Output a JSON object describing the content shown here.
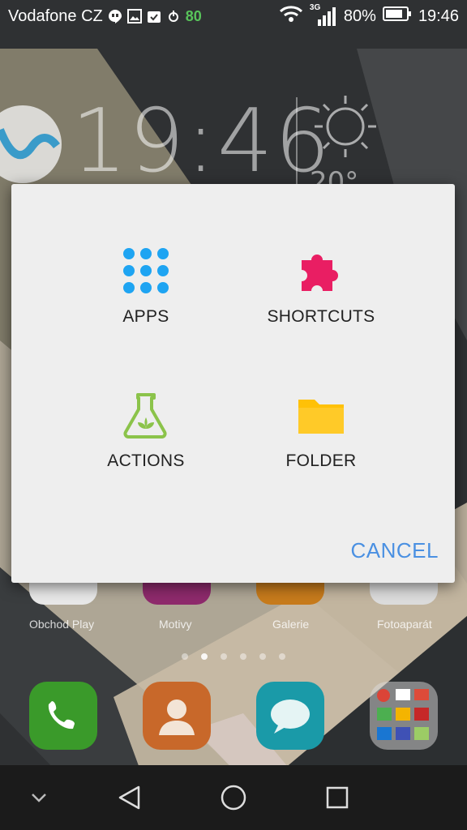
{
  "status_bar": {
    "carrier": "Vodafone CZ",
    "notification_badge": "80",
    "network_type": "3G",
    "battery": "80%",
    "time": "19:46"
  },
  "clock_widget": {
    "time": "19:46",
    "temperature": "20°",
    "weather_icon": "sun-icon"
  },
  "dialog": {
    "options": [
      {
        "label": "APPS",
        "icon": "apps-grid-icon",
        "color": "#1ea4f2"
      },
      {
        "label": "SHORTCUTS",
        "icon": "puzzle-piece-icon",
        "color": "#e91e63"
      },
      {
        "label": "ACTIONS",
        "icon": "flask-icon",
        "color": "#8bc34a"
      },
      {
        "label": "FOLDER",
        "icon": "folder-icon",
        "color": "#ffc107"
      }
    ],
    "cancel_label": "CANCEL",
    "accent_color": "#4a90e2"
  },
  "homescreen": {
    "app_labels": [
      "Obchod Play",
      "Motivy",
      "Galerie",
      "Fotoaparát"
    ],
    "page_indicator": {
      "pages": 6,
      "active": 2
    },
    "dock": [
      "phone-icon",
      "contacts-icon",
      "messages-icon",
      "folder-apps-icon"
    ]
  },
  "nav_bar": [
    "chevron-down-icon",
    "back-icon",
    "home-icon",
    "recents-icon"
  ]
}
